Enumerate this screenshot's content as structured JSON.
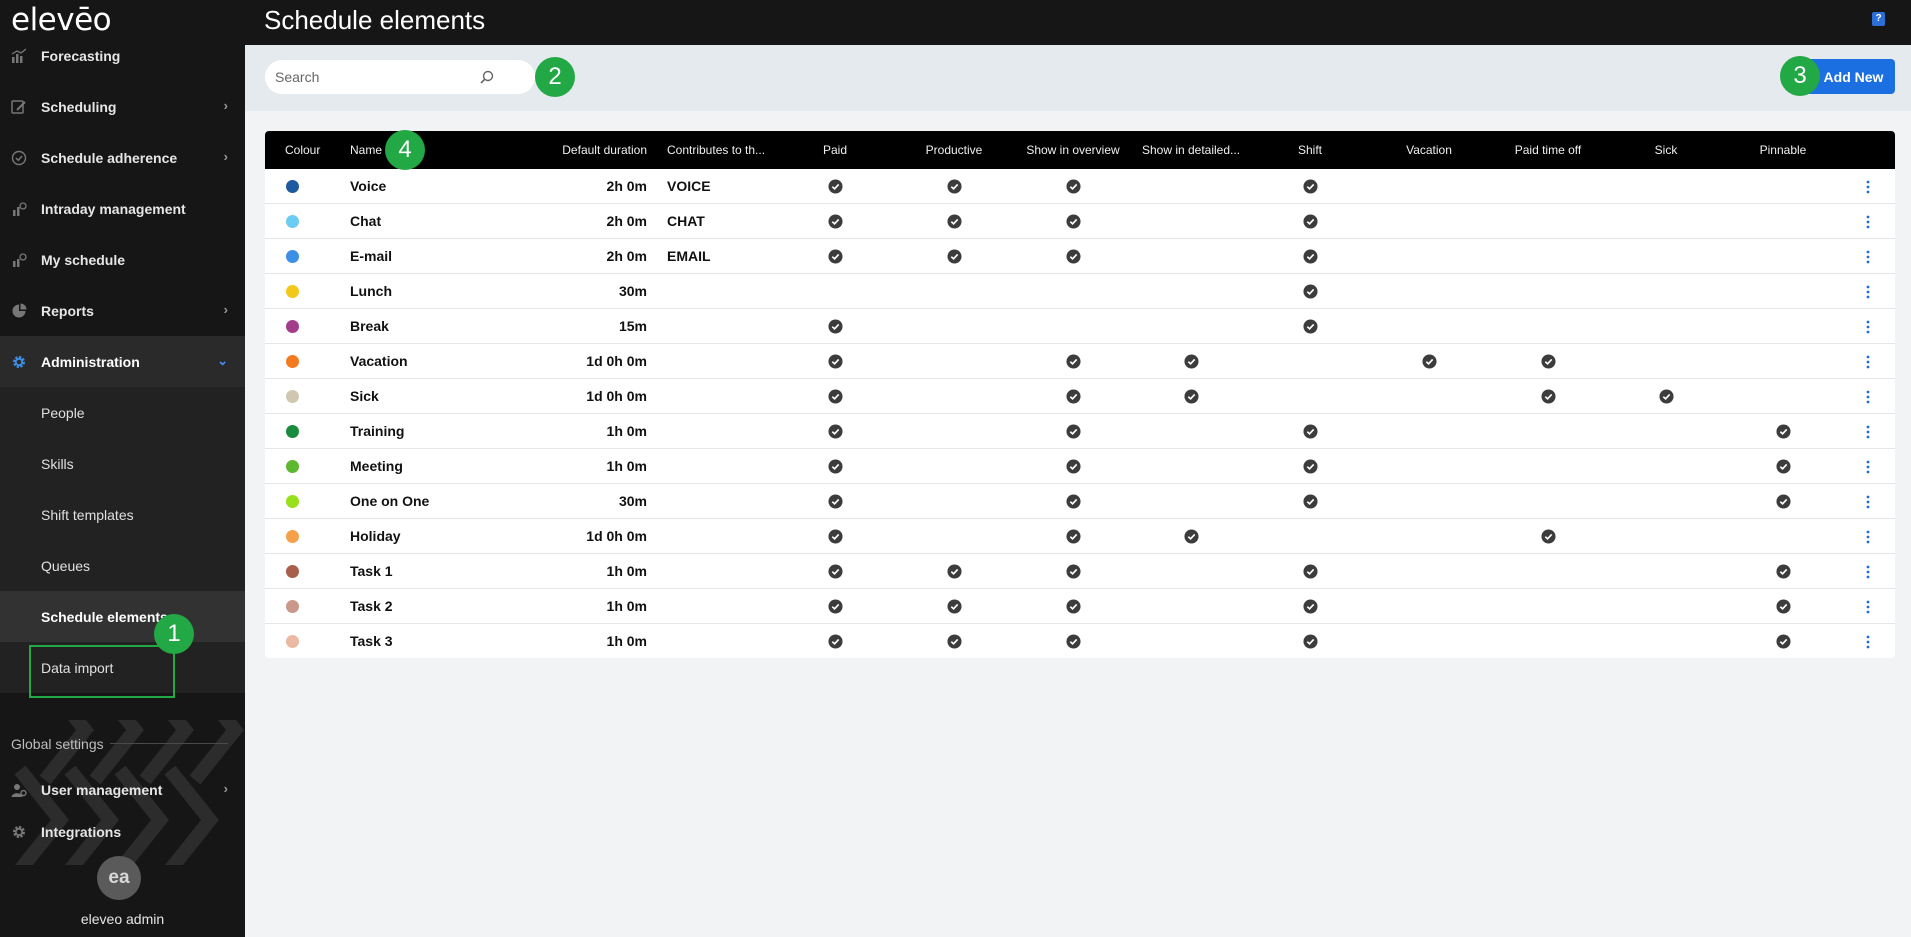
{
  "app": {
    "logo": "elevēo"
  },
  "header": {
    "title": "Schedule elements",
    "help_icon": "help-book-icon"
  },
  "sidebar": {
    "items": [
      {
        "label": "Forecasting",
        "icon": "forecast-chart-icon",
        "chevron": false
      },
      {
        "label": "Scheduling",
        "icon": "scheduling-icon",
        "chevron": true
      },
      {
        "label": "Schedule adherence",
        "icon": "adherence-check-icon",
        "chevron": true
      },
      {
        "label": "Intraday management",
        "icon": "intraday-chart-icon",
        "chevron": false
      },
      {
        "label": "My schedule",
        "icon": "my-schedule-icon",
        "chevron": false
      },
      {
        "label": "Reports",
        "icon": "pie-chart-icon",
        "chevron": true
      },
      {
        "label": "Administration",
        "icon": "gear-icon",
        "chevron": true,
        "expanded": true
      }
    ],
    "admin_sub": [
      "People",
      "Skills",
      "Shift templates",
      "Queues",
      "Schedule elements",
      "Data import"
    ],
    "selected_sub": "Schedule elements",
    "global_settings_label": "Global settings",
    "bottom_items": [
      {
        "label": "User management",
        "icon": "user-management-icon",
        "chevron": true
      },
      {
        "label": "Integrations",
        "icon": "gear-icon",
        "chevron": false
      }
    ],
    "user": {
      "initials": "ea",
      "name": "eleveo admin"
    }
  },
  "toolbar": {
    "search_placeholder": "Search",
    "add_label": "Add New"
  },
  "badges": [
    "1",
    "2",
    "3",
    "4"
  ],
  "colors": {
    "accent": "#1c6fe0",
    "badge": "#22a845",
    "sidebar": "#161616"
  },
  "table": {
    "columns": [
      "Colour",
      "Name",
      "Default duration",
      "Contributes to th...",
      "Paid",
      "Productive",
      "Show in overview",
      "Show in detailed...",
      "Shift",
      "Vacation",
      "Paid time off",
      "Sick",
      "Pinnable"
    ],
    "rows": [
      {
        "color": "#1e5aa0",
        "name": "Voice",
        "duration": "2h 0m",
        "contributes": "VOICE",
        "paid": true,
        "productive": true,
        "overview": true,
        "detailed": false,
        "shift": true,
        "vacation": false,
        "pto": false,
        "sick": false,
        "pinnable": false
      },
      {
        "color": "#6ccbf2",
        "name": "Chat",
        "duration": "2h 0m",
        "contributes": "CHAT",
        "paid": true,
        "productive": true,
        "overview": true,
        "detailed": false,
        "shift": true,
        "vacation": false,
        "pto": false,
        "sick": false,
        "pinnable": false
      },
      {
        "color": "#3d8fe6",
        "name": "E-mail",
        "duration": "2h 0m",
        "contributes": "EMAIL",
        "paid": true,
        "productive": true,
        "overview": true,
        "detailed": false,
        "shift": true,
        "vacation": false,
        "pto": false,
        "sick": false,
        "pinnable": false
      },
      {
        "color": "#f2c81b",
        "name": "Lunch",
        "duration": "30m",
        "contributes": "",
        "paid": false,
        "productive": false,
        "overview": false,
        "detailed": false,
        "shift": true,
        "vacation": false,
        "pto": false,
        "sick": false,
        "pinnable": false
      },
      {
        "color": "#a23d8c",
        "name": "Break",
        "duration": "15m",
        "contributes": "",
        "paid": true,
        "productive": false,
        "overview": false,
        "detailed": false,
        "shift": true,
        "vacation": false,
        "pto": false,
        "sick": false,
        "pinnable": false
      },
      {
        "color": "#f47a20",
        "name": "Vacation",
        "duration": "1d 0h 0m",
        "contributes": "",
        "paid": true,
        "productive": false,
        "overview": true,
        "detailed": true,
        "shift": false,
        "vacation": true,
        "pto": true,
        "sick": false,
        "pinnable": false
      },
      {
        "color": "#cfc7b0",
        "name": "Sick",
        "duration": "1d 0h 0m",
        "contributes": "",
        "paid": true,
        "productive": false,
        "overview": true,
        "detailed": true,
        "shift": false,
        "vacation": false,
        "pto": true,
        "sick": true,
        "pinnable": false
      },
      {
        "color": "#1a8a3c",
        "name": "Training",
        "duration": "1h 0m",
        "contributes": "",
        "paid": true,
        "productive": false,
        "overview": true,
        "detailed": false,
        "shift": true,
        "vacation": false,
        "pto": false,
        "sick": false,
        "pinnable": true
      },
      {
        "color": "#5cb82e",
        "name": "Meeting",
        "duration": "1h 0m",
        "contributes": "",
        "paid": true,
        "productive": false,
        "overview": true,
        "detailed": false,
        "shift": true,
        "vacation": false,
        "pto": false,
        "sick": false,
        "pinnable": true
      },
      {
        "color": "#98e01a",
        "name": "One on One",
        "duration": "30m",
        "contributes": "",
        "paid": true,
        "productive": false,
        "overview": true,
        "detailed": false,
        "shift": true,
        "vacation": false,
        "pto": false,
        "sick": false,
        "pinnable": true
      },
      {
        "color": "#f5a04a",
        "name": "Holiday",
        "duration": "1d 0h 0m",
        "contributes": "",
        "paid": true,
        "productive": false,
        "overview": true,
        "detailed": true,
        "shift": false,
        "vacation": false,
        "pto": true,
        "sick": false,
        "pinnable": false
      },
      {
        "color": "#a8604a",
        "name": "Task 1",
        "duration": "1h 0m",
        "contributes": "",
        "paid": true,
        "productive": true,
        "overview": true,
        "detailed": false,
        "shift": true,
        "vacation": false,
        "pto": false,
        "sick": false,
        "pinnable": true
      },
      {
        "color": "#c9988a",
        "name": "Task 2",
        "duration": "1h 0m",
        "contributes": "",
        "paid": true,
        "productive": true,
        "overview": true,
        "detailed": false,
        "shift": true,
        "vacation": false,
        "pto": false,
        "sick": false,
        "pinnable": true
      },
      {
        "color": "#ebb8a2",
        "name": "Task 3",
        "duration": "1h 0m",
        "contributes": "",
        "paid": true,
        "productive": true,
        "overview": true,
        "detailed": false,
        "shift": true,
        "vacation": false,
        "pto": false,
        "sick": false,
        "pinnable": true
      }
    ]
  }
}
